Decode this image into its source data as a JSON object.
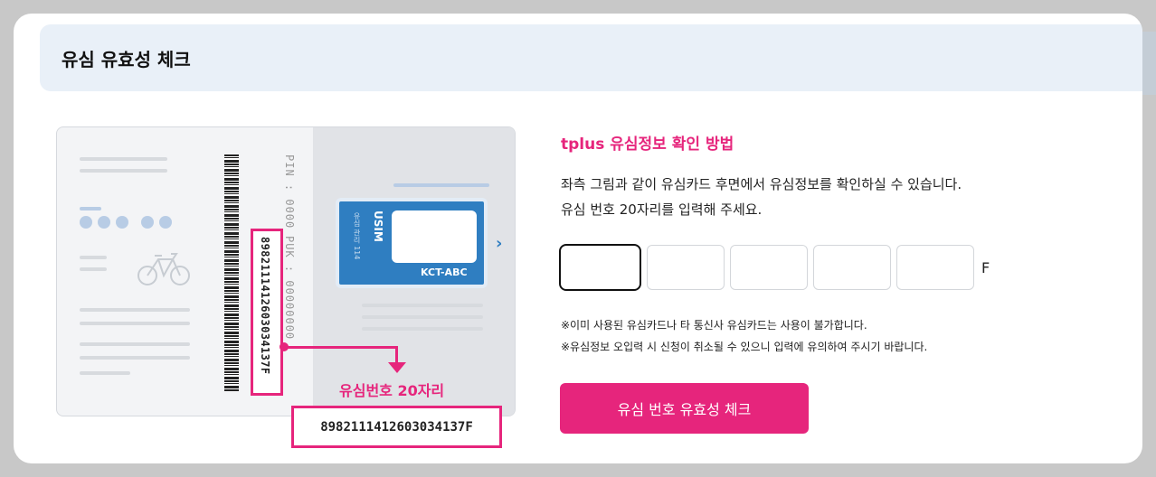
{
  "header": {
    "title": "유심 유효성 체크"
  },
  "illustration": {
    "pin_label": "PIN : 0000",
    "puk_label": "PUK : 00000000",
    "vertical_number": "89821114126030341 37F",
    "sim_label": "USIM",
    "sim_small_label": "유심 관리 114",
    "sim_chip_label": "KCT-ABC",
    "number_caption": "유심번호 20자리",
    "number_display": "8982111412603034137F"
  },
  "info": {
    "title": "tplus 유심정보 확인 방법",
    "desc_line1": "좌측 그림과 같이 유심카드 후면에서 유심정보를 확인하실 수 있습니다.",
    "desc_line2": "유심 번호 20자리를 입력해 주세요.",
    "input_suffix": "F",
    "note1": "※이미 사용된 유심카드나 타 통신사 유심카드는 사용이 불가합니다.",
    "note2": "※유심정보 오입력 시 신청이 취소될 수 있으니 입력에 유의하여 주시기 바랍니다.",
    "button_label": "유심 번호 유효성 체크"
  },
  "colors": {
    "accent": "#e6257c",
    "sim_blue": "#2f7ec1"
  }
}
